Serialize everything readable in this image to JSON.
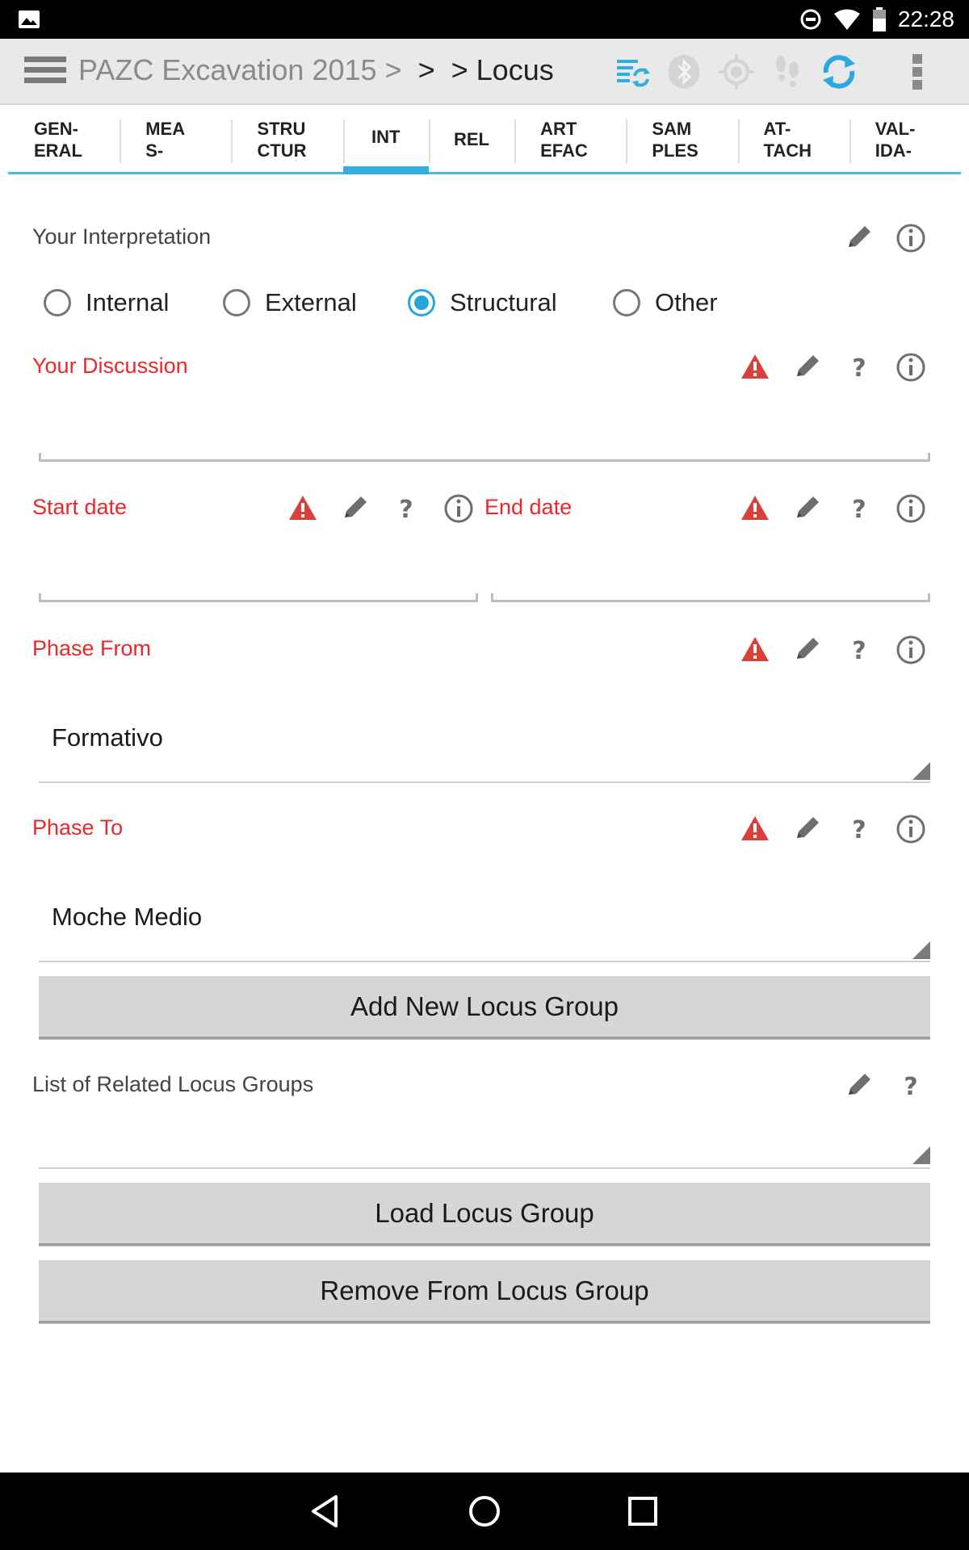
{
  "status_bar": {
    "time": "22:28"
  },
  "action_bar": {
    "breadcrumb_project": "PAZC Excavation 2015 >",
    "breadcrumb_sep": ">",
    "breadcrumb_current": "> Locus"
  },
  "tabs": [
    {
      "label": "GEN-\nERAL"
    },
    {
      "label": "MEA\nS-"
    },
    {
      "label": "STRU\nCTUR"
    },
    {
      "label": "INT",
      "active": true
    },
    {
      "label": "REL"
    },
    {
      "label": "ART\nEFAC"
    },
    {
      "label": "SAM\nPLES"
    },
    {
      "label": "AT-\nTACH"
    },
    {
      "label": "VAL-\nIDA-"
    }
  ],
  "form": {
    "interpretation": {
      "label": "Your Interpretation",
      "options": [
        "Internal",
        "External",
        "Structural",
        "Other"
      ],
      "selected": "Structural"
    },
    "discussion": {
      "label": "Your Discussion",
      "value": ""
    },
    "start_date": {
      "label": "Start date",
      "value": ""
    },
    "end_date": {
      "label": "End date",
      "value": ""
    },
    "phase_from": {
      "label": "Phase From",
      "value": "Formativo"
    },
    "phase_to": {
      "label": "Phase To",
      "value": "Moche Medio"
    },
    "add_group_button": "Add New Locus Group",
    "related_groups": {
      "label": "List of Related Locus Groups",
      "value": ""
    },
    "load_group_button": "Load Locus Group",
    "remove_group_button": "Remove From Locus Group"
  },
  "colors": {
    "accent": "#33aee0",
    "required_label": "#e8282b",
    "warning": "#d9403a"
  }
}
